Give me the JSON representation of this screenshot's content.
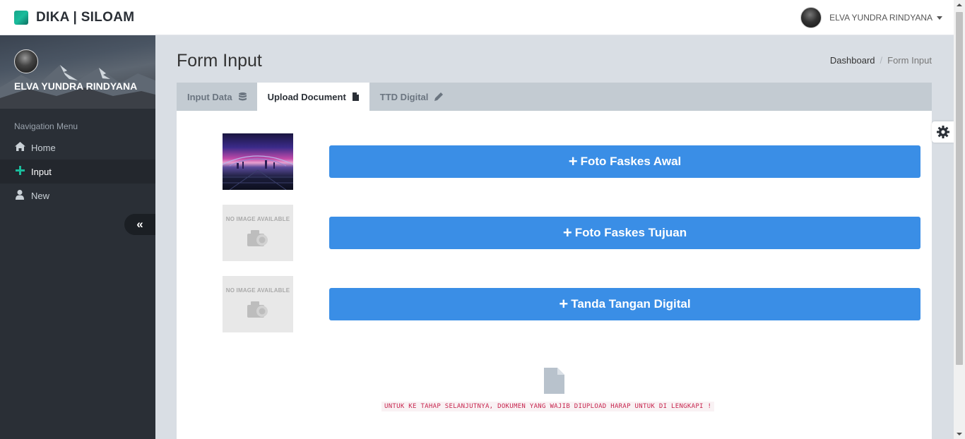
{
  "brand": {
    "name": "DIKA | SILOAM",
    "logo_color": "#1abc9c"
  },
  "user": {
    "name": "ELVA YUNDRA RINDYANA"
  },
  "sidebar": {
    "profile_name": "ELVA YUNDRA RINDYANA",
    "nav_title": "Navigation Menu",
    "items": [
      {
        "label": "Home",
        "icon": "home-icon"
      },
      {
        "label": "Input",
        "icon": "plus-icon",
        "active": true
      },
      {
        "label": "New",
        "icon": "user-icon"
      }
    ],
    "collapse_icon": "«"
  },
  "page": {
    "title": "Form Input",
    "breadcrumb": {
      "link": "Dashboard",
      "separator": "/",
      "current": "Form Input"
    }
  },
  "tabs": [
    {
      "label": "Input Data",
      "icon": "database-icon"
    },
    {
      "label": "Upload Document",
      "icon": "file-icon",
      "active": true
    },
    {
      "label": "TTD Digital",
      "icon": "pencil-icon"
    }
  ],
  "documents": [
    {
      "button_label": "Foto Faskes Awal",
      "has_image": true
    },
    {
      "button_label": "Foto Faskes Tujuan",
      "has_image": false,
      "placeholder_text": "NO IMAGE AVAILABLE"
    },
    {
      "button_label": "Tanda Tangan Digital",
      "has_image": false,
      "placeholder_text": "NO IMAGE AVAILABLE"
    }
  ],
  "notice": "UNTUK KE TAHAP SELANJUTNYA, DOKUMEN YANG WAJIB DIUPLOAD HARAP UNTUK DI LENGKAPI !",
  "colors": {
    "primary_button": "#3a8ee6",
    "sidebar_bg": "#2a2f36",
    "notice_text": "#c7254e",
    "accent": "#1abc9c"
  }
}
